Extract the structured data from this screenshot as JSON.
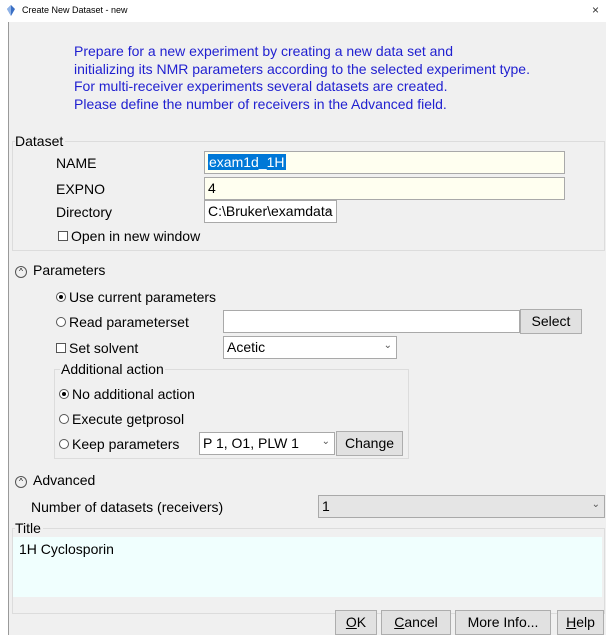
{
  "window": {
    "title": "Create New Dataset - new",
    "close": "×"
  },
  "intro": [
    "Prepare for a new experiment by creating a new data set and",
    "initializing its NMR parameters according to the selected experiment type.",
    "For multi-receiver experiments several datasets are created.",
    "Please define the number of receivers in the Advanced field."
  ],
  "dataset": {
    "label": "Dataset",
    "name_label": "NAME",
    "name_value": "exam1d_1H",
    "expno_label": "EXPNO",
    "expno_value": "4",
    "directory_label": "Directory",
    "directory_value": "C:\\Bruker\\examdata",
    "open_new_window": "Open in new window"
  },
  "parameters": {
    "label": "Parameters",
    "use_current": "Use current parameters",
    "read_paramset": "Read parameterset",
    "read_paramset_value": "",
    "select_button": "Select",
    "set_solvent": "Set solvent",
    "solvent_value": "Acetic",
    "additional_action": {
      "label": "Additional action",
      "no_action": "No additional action",
      "execute_getprosol": "Execute getprosol",
      "keep_parameters": "Keep parameters",
      "keep_value": "P 1, O1, PLW 1",
      "change_button": "Change"
    }
  },
  "advanced": {
    "label": "Advanced",
    "num_datasets_label": "Number of datasets (receivers)",
    "num_datasets_value": "1"
  },
  "title_section": {
    "label": "Title",
    "value": "1H Cyclosporin"
  },
  "buttons": {
    "ok_u": "O",
    "ok_rest": "K",
    "cancel_u": "C",
    "cancel_rest": "ancel",
    "more_info": "More Info...",
    "help_u": "H",
    "help_rest": "elp"
  },
  "chevron": "⌄"
}
